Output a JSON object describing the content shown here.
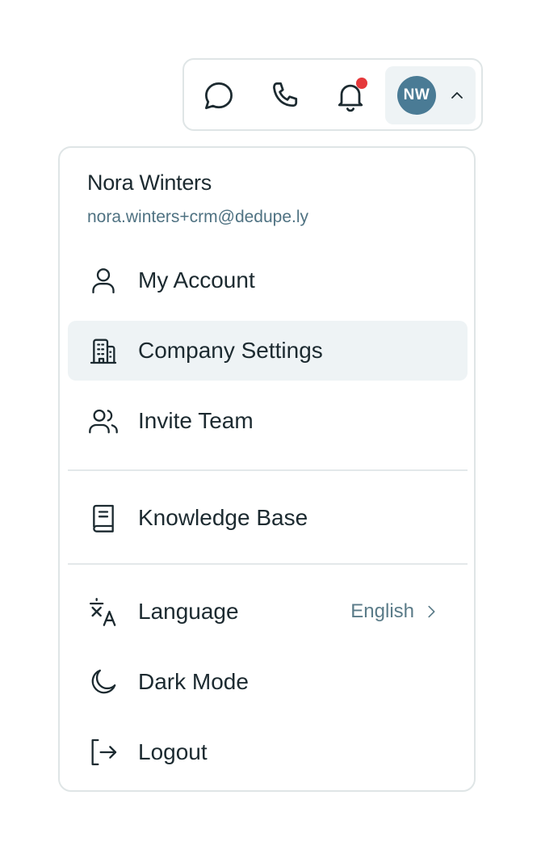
{
  "topbar": {
    "icons": [
      "chat-icon",
      "phone-icon",
      "bell-icon"
    ],
    "notification_dot_color": "#e5383b",
    "avatar_initials": "NW",
    "avatar_color": "#4a7b95"
  },
  "user": {
    "name": "Nora Winters",
    "email": "nora.winters+crm@dedupe.ly"
  },
  "menu": {
    "account": {
      "label": "My Account",
      "icon": "user-icon"
    },
    "company": {
      "label": "Company Settings",
      "icon": "building-icon",
      "active": true
    },
    "invite": {
      "label": "Invite Team",
      "icon": "users-icon"
    },
    "knowledge": {
      "label": "Knowledge Base",
      "icon": "book-icon"
    },
    "language": {
      "label": "Language",
      "value": "English",
      "icon": "translate-icon"
    },
    "dark_mode": {
      "label": "Dark Mode",
      "icon": "moon-icon"
    },
    "logout": {
      "label": "Logout",
      "icon": "logout-icon"
    }
  }
}
